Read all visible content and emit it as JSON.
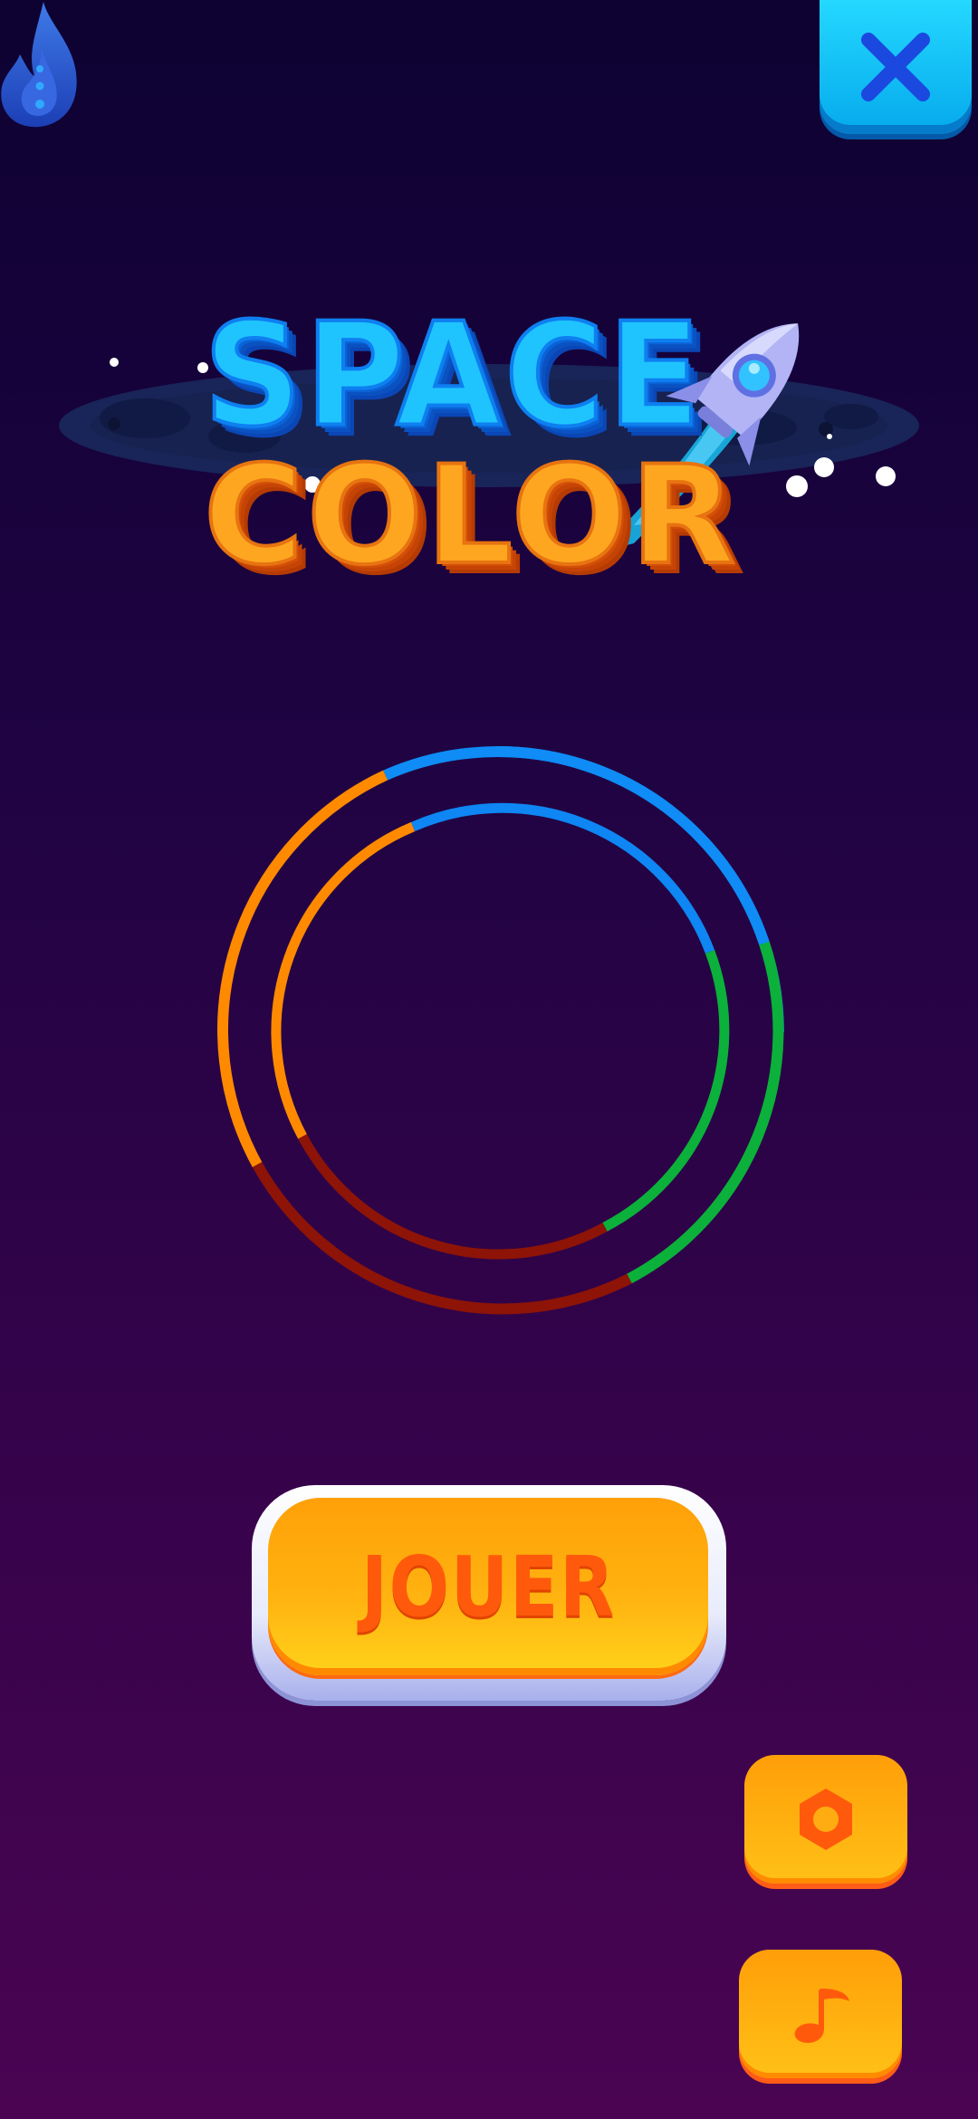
{
  "app": {
    "title_line1": "SPACE",
    "title_line2": "COLOR"
  },
  "buttons": {
    "play_label": "JOUER"
  },
  "icons": {
    "top_left": "flame-icon",
    "close": "close-icon",
    "settings": "hexagon-icon",
    "music": "music-note-icon",
    "logo_decoration": "rocket-icon"
  },
  "colors": {
    "ring_blue": "#0d7cf4",
    "ring_green": "#0bb13a",
    "ring_red": "#8d1406",
    "ring_orange": "#ff8a00",
    "play_fill": "#ffb210",
    "play_text": "#ff5a0c",
    "close_fill": "#14c2f8"
  }
}
